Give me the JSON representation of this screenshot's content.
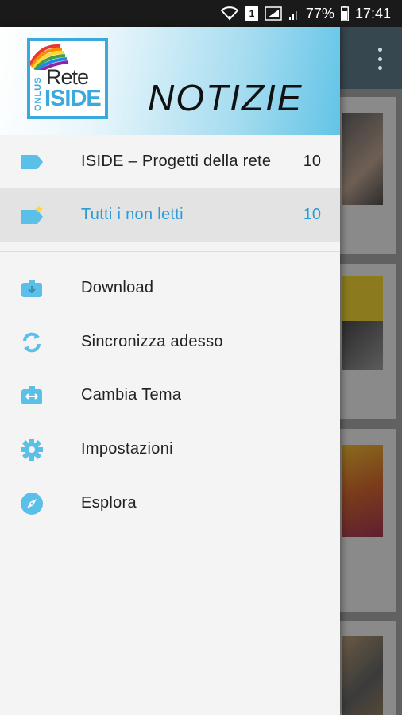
{
  "status_bar": {
    "battery": "77%",
    "time": "17:41",
    "sim_slot": "1"
  },
  "drawer": {
    "header": {
      "logo": {
        "line1": "Rete",
        "line2": "ISIDE",
        "side": "ONLUS"
      },
      "title": "NOTIZIE"
    },
    "feeds": [
      {
        "label": "ISIDE – Progetti della rete",
        "count": "10",
        "icon": "tag-icon",
        "selected": false
      },
      {
        "label": "Tutti i non letti",
        "count": "10",
        "icon": "tag-star-icon",
        "selected": true
      }
    ],
    "actions": [
      {
        "label": "Download",
        "icon": "download-icon"
      },
      {
        "label": "Sincronizza adesso",
        "icon": "sync-icon"
      },
      {
        "label": "Cambia Tema",
        "icon": "theme-icon"
      },
      {
        "label": "Impostazioni",
        "icon": "settings-icon"
      },
      {
        "label": "Esplora",
        "icon": "compass-icon"
      }
    ]
  },
  "colors": {
    "accent": "#2b9bd8",
    "icon": "#5bc0e8",
    "toolbar": "#37474f"
  }
}
